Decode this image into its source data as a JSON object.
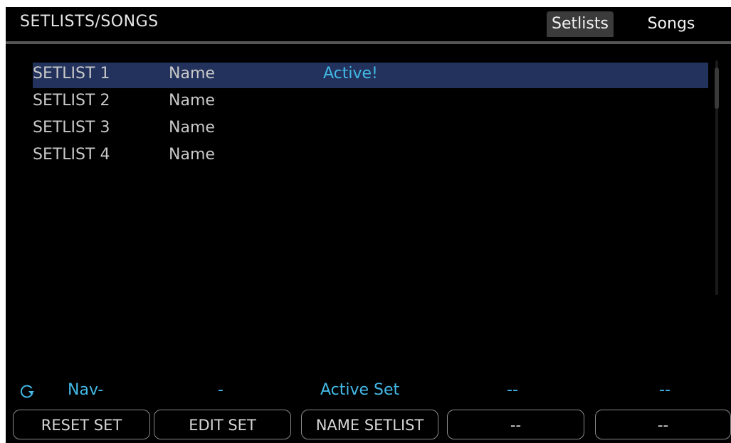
{
  "header": {
    "title": "SETLISTS/SONGS",
    "tabs": [
      {
        "label": "Setlists",
        "active": true
      },
      {
        "label": "Songs",
        "active": false
      }
    ]
  },
  "list": {
    "rows": [
      {
        "slot": "SETLIST 1",
        "name": "Name",
        "status": "Active!",
        "selected": true
      },
      {
        "slot": "SETLIST 2",
        "name": "Name",
        "status": "",
        "selected": false
      },
      {
        "slot": "SETLIST 3",
        "name": "Name",
        "status": "",
        "selected": false
      },
      {
        "slot": "SETLIST 4",
        "name": "Name",
        "status": "",
        "selected": false
      }
    ]
  },
  "knobs": {
    "icon": "refresh-icon",
    "labels": [
      "Nav-",
      "-",
      "Active Set",
      "--",
      "--"
    ]
  },
  "softkeys": {
    "labels": [
      "RESET SET",
      "EDIT SET",
      "NAME SETLIST",
      "--",
      "--"
    ]
  },
  "colors": {
    "accent": "#43b9e6",
    "selection": "#22325c",
    "active_tab": "#3b3b3b"
  }
}
